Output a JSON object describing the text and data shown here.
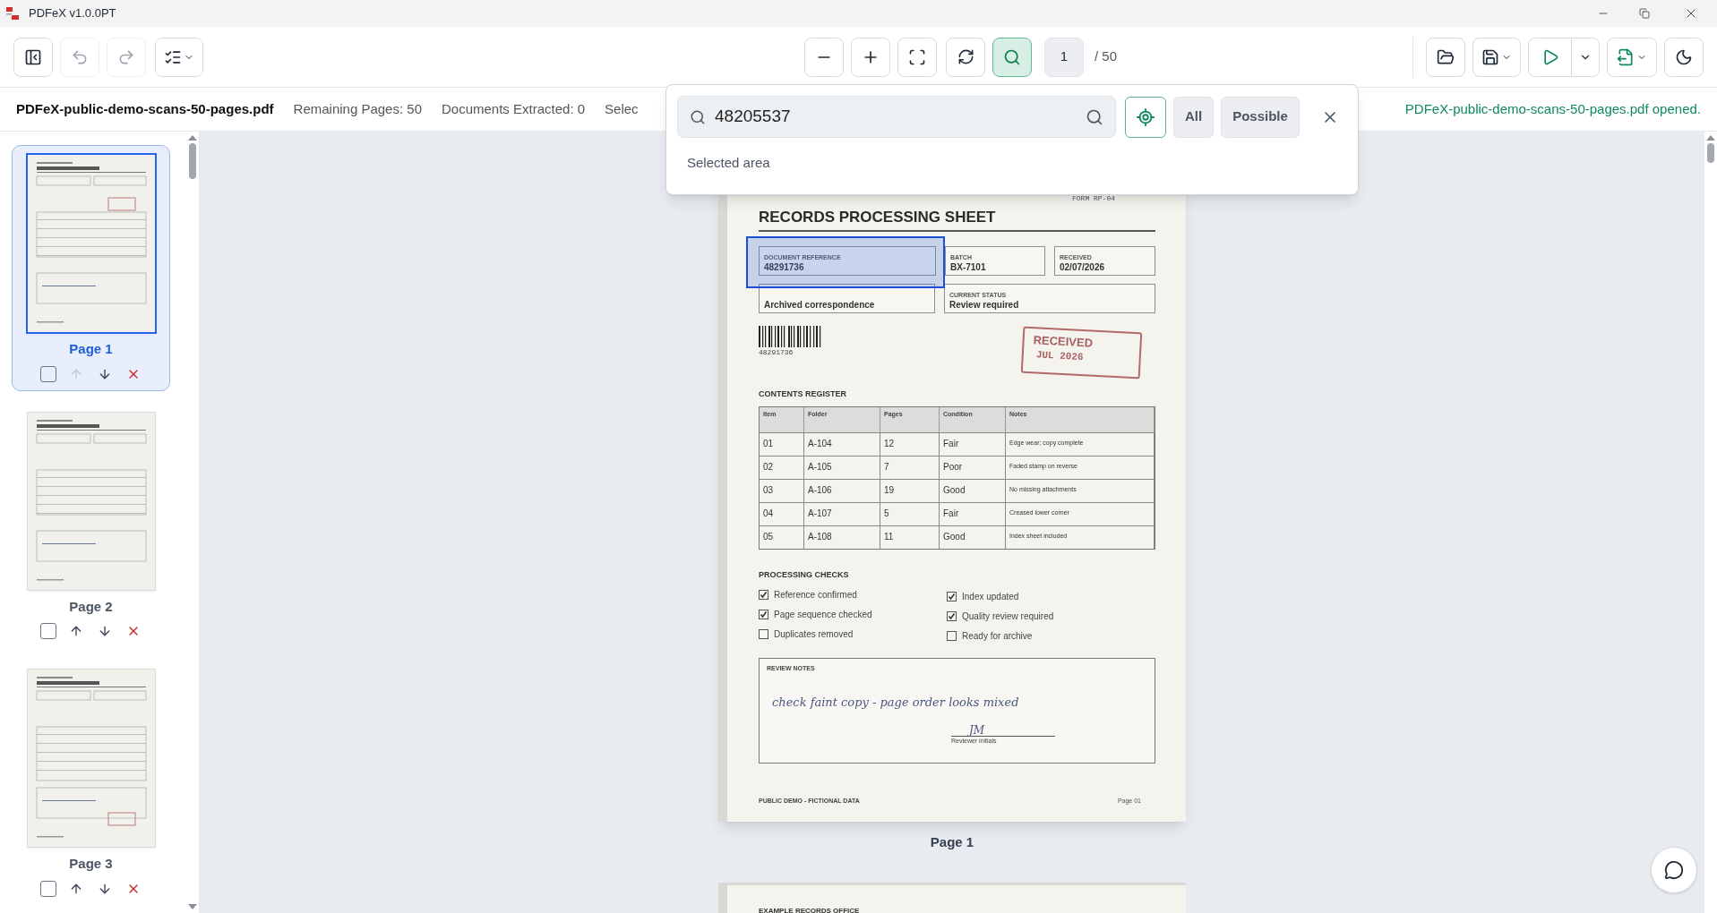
{
  "window": {
    "title": "PDFeX v1.0.0PT"
  },
  "toolbar": {
    "undo_disabled": true,
    "redo_disabled": true,
    "search_active": true,
    "page_number": "1",
    "page_total": "/ 50"
  },
  "info_bar": {
    "file_name": "PDFeX-public-demo-scans-50-pages.pdf",
    "stats": [
      "Remaining Pages: 50",
      "Documents Extracted: 0",
      "Selec"
    ],
    "status": "PDFeX-public-demo-scans-50-pages.pdf opened."
  },
  "search_popup": {
    "query": "48205537",
    "filters": [
      {
        "label": "All"
      },
      {
        "label": "Possible"
      }
    ],
    "hint": "Selected area"
  },
  "sidebar": {
    "pages": [
      {
        "label": "Page 1",
        "selected": true,
        "checked": false,
        "move_up_disabled": true
      },
      {
        "label": "Page 2",
        "selected": false,
        "checked": false,
        "move_up_disabled": false
      },
      {
        "label": "Page 3",
        "selected": false,
        "checked": false,
        "move_up_disabled": false
      }
    ]
  },
  "document": {
    "form_code": "FORM RP-04",
    "title": "RECORDS PROCESSING SHEET",
    "fields": [
      {
        "label": "DOCUMENT REFERENCE",
        "value": "48291736",
        "highlighted": true
      },
      {
        "label": "BATCH",
        "value": "BX-7101",
        "highlighted": false
      },
      {
        "label": "RECEIVED",
        "value": "02/07/2026",
        "highlighted": false
      },
      {
        "value": "Archived correspondence",
        "highlighted": false
      },
      {
        "label": "CURRENT STATUS",
        "value": "Review required",
        "highlighted": false
      }
    ],
    "barcode": "48291736",
    "stamp": [
      "RECEIVED",
      "JUL 2026"
    ],
    "register_title": "CONTENTS REGISTER",
    "columns": [
      "Item",
      "Folder",
      "Pages",
      "Condition",
      "Notes"
    ],
    "rows": [
      [
        "01",
        "A-104",
        "12",
        "Fair",
        "Edge wear; copy complete"
      ],
      [
        "02",
        "A-105",
        "7",
        "Poor",
        "Faded stamp on reverse"
      ],
      [
        "03",
        "A-106",
        "19",
        "Good",
        "No missing attachments"
      ],
      [
        "04",
        "A-107",
        "5",
        "Fair",
        "Creased lower corner"
      ],
      [
        "05",
        "A-108",
        "11",
        "Good",
        "Index sheet included"
      ]
    ],
    "checks_title": "PROCESSING CHECKS",
    "check_columns": [
      [
        {
          "label": "Reference confirmed",
          "checked": true
        },
        {
          "label": "Page sequence checked",
          "checked": true
        },
        {
          "label": "Duplicates removed",
          "checked": false
        }
      ],
      [
        {
          "label": "Index updated",
          "checked": true
        },
        {
          "label": "Quality review required",
          "checked": true
        },
        {
          "label": "Ready for archive",
          "checked": false
        }
      ]
    ],
    "notes_title": "REVIEW NOTES",
    "notes": "check faint copy - page order looks mixed",
    "initials": "JM",
    "initials_label": "Reviewer initials",
    "footer": "PUBLIC DEMO - FICTIONAL DATA",
    "page_code": "Page 01",
    "caption": "Page 1"
  },
  "next_page": {
    "heading": "EXAMPLE RECORDS OFFICE"
  }
}
